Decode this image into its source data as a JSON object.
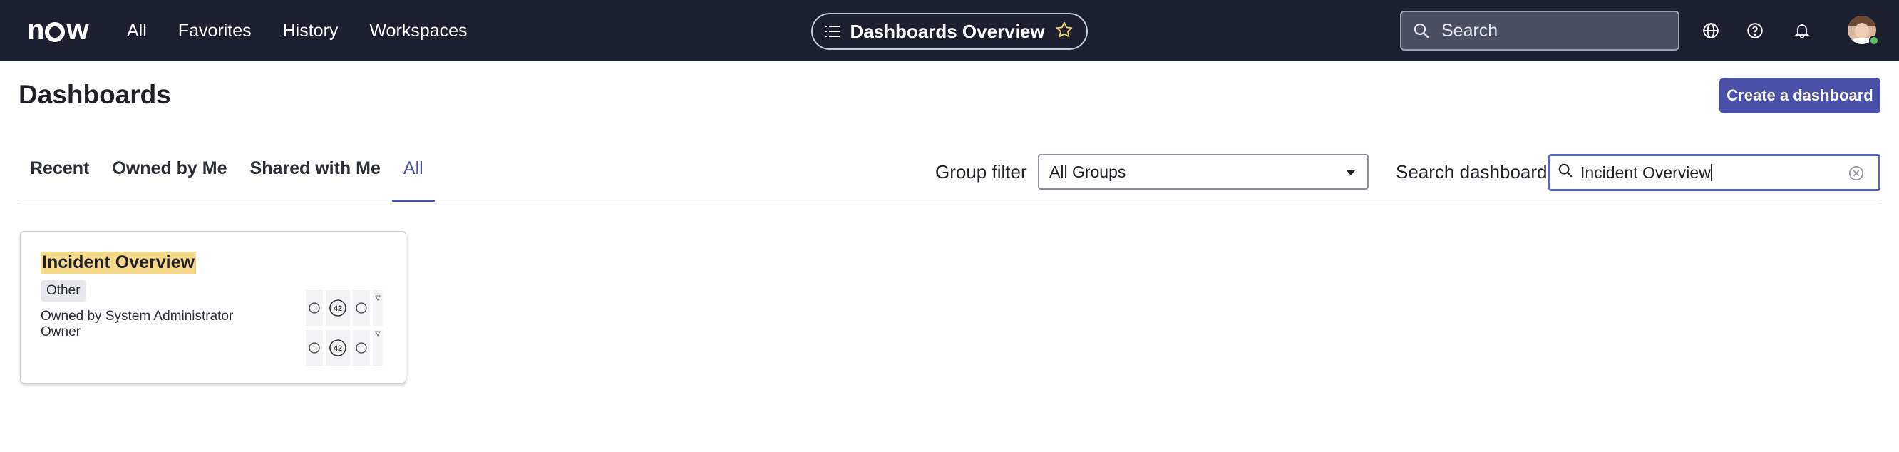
{
  "topbar": {
    "logo_text": "now",
    "nav": [
      "All",
      "Favorites",
      "History",
      "Workspaces"
    ],
    "current_page": "Dashboards Overview",
    "search_placeholder": "Search",
    "icons": [
      "globe-icon",
      "help-icon",
      "bell-icon"
    ]
  },
  "header": {
    "title": "Dashboards",
    "create_button": "Create a dashboard"
  },
  "tabs": [
    {
      "label": "Recent",
      "active": false
    },
    {
      "label": "Owned by Me",
      "active": false
    },
    {
      "label": "Shared with Me",
      "active": false
    },
    {
      "label": "All",
      "active": true
    }
  ],
  "filters": {
    "group_label": "Group filter",
    "group_value": "All Groups",
    "search_label": "Search dashboard",
    "search_value": "Incident Overview"
  },
  "cards": [
    {
      "title": "Incident Overview",
      "category": "Other",
      "owned_by": "Owned by System Administrator",
      "role": "Owner",
      "thumb_value": "42"
    }
  ],
  "colors": {
    "topbar_bg": "#1c1f2e",
    "accent": "#4a4fa8",
    "highlight": "#f7d98c"
  }
}
